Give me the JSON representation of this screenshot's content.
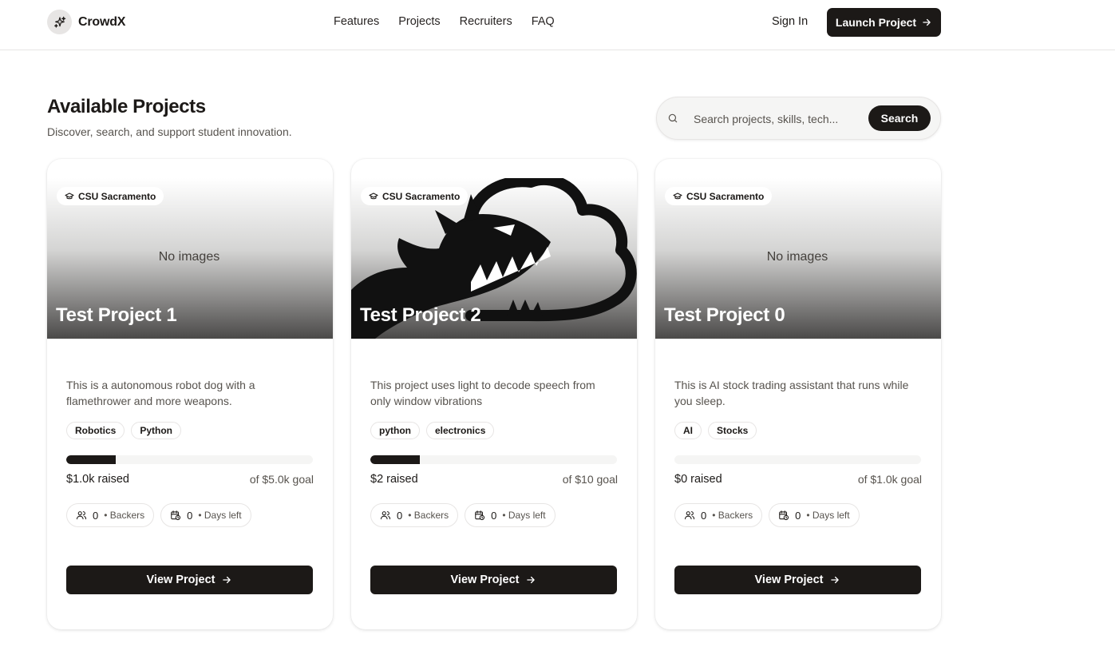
{
  "header": {
    "logo_icon": "sparkles-icon",
    "logo_text": "CrowdX",
    "nav": [
      "Features",
      "Projects",
      "Recruiters",
      "FAQ"
    ],
    "sign_in": "Sign In",
    "launch_label": "Launch Project"
  },
  "section": {
    "title": "Available Projects",
    "subtitle": "Discover, search, and support student innovation."
  },
  "search": {
    "placeholder": "Search projects, skills, tech...",
    "button": "Search"
  },
  "colors": {
    "primary": "#1c1917",
    "muted": "#57534e",
    "border": "#e7e5e4"
  },
  "projects": [
    {
      "school": "CSU Sacramento",
      "media_text": "No images",
      "title": "Test Project 1",
      "description": "This is a autonomous robot dog with a flamethrower and more weapons.",
      "tags": [
        "Robotics",
        "Python"
      ],
      "progress": 0.2,
      "raised": "$1.0k raised",
      "goal": "of $5.0k goal",
      "backers": "0",
      "backers_label": "• Backers",
      "days": "0",
      "days_label": "• Days left",
      "button": "View Project"
    },
    {
      "school": "CSU Sacramento",
      "media_text": "",
      "title": "Test Project 2",
      "description": "This project uses light to decode speech from only window vibrations",
      "tags": [
        "python",
        "electronics"
      ],
      "progress": 0.2,
      "raised": "$2 raised",
      "goal": "of $10 goal",
      "backers": "0",
      "backers_label": "• Backers",
      "days": "0",
      "days_label": "• Days left",
      "button": "View Project"
    },
    {
      "school": "CSU Sacramento",
      "media_text": "No images",
      "title": "Test Project 0",
      "description": "This is AI stock trading assistant that runs while you sleep.",
      "tags": [
        "AI",
        "Stocks"
      ],
      "progress": 0,
      "raised": "$0 raised",
      "goal": "of $1.0k goal",
      "backers": "0",
      "backers_label": "• Backers",
      "days": "0",
      "days_label": "• Days left",
      "button": "View Project"
    }
  ]
}
